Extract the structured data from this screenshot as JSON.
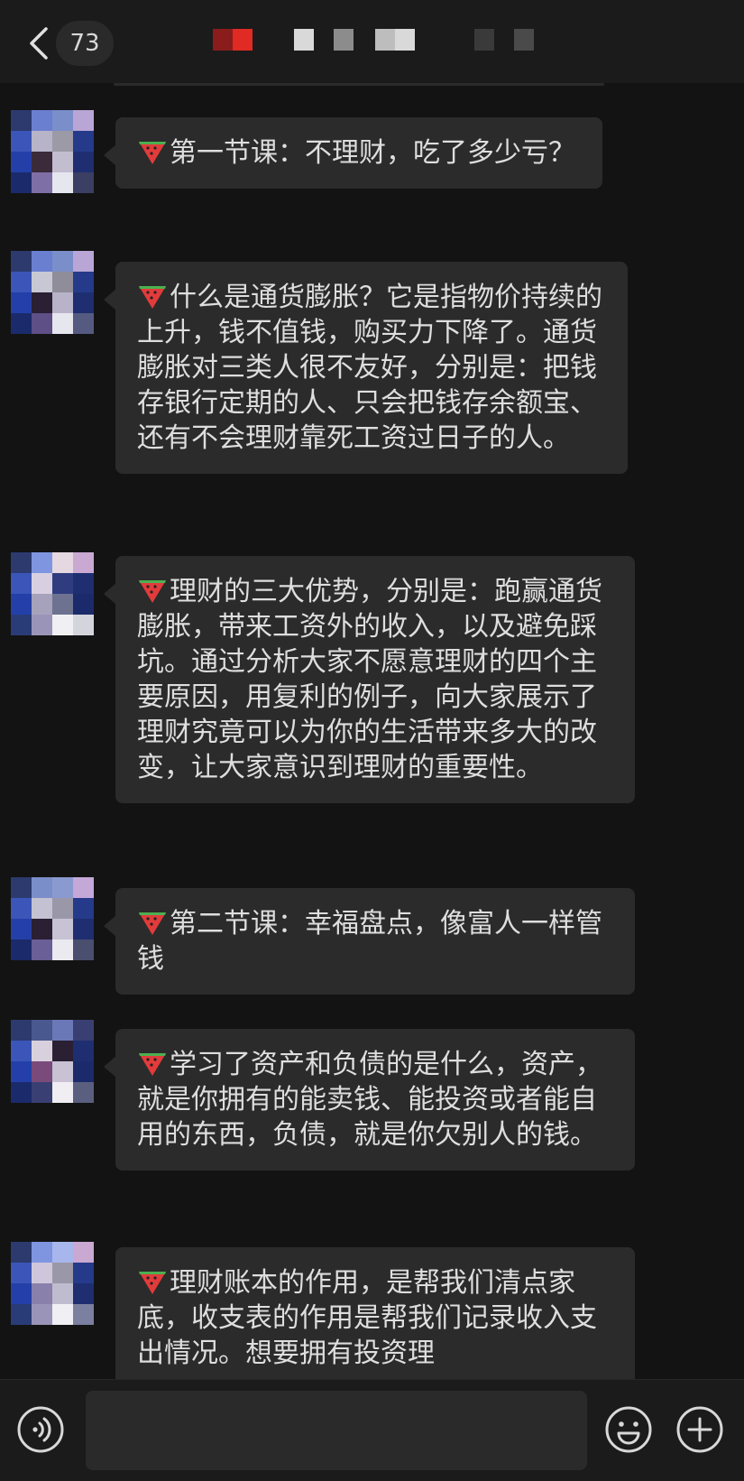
{
  "header": {
    "unread_count": "73"
  },
  "messages": [
    {
      "text": "第一节课：不理财，吃了多少亏？"
    },
    {
      "text": "什么是通货膨胀？它是指物价持续的上升，钱不值钱，购买力下降了。通货膨胀对三类人很不友好，分别是：把钱存银行定期的人、只会把钱存余额宝、还有不会理财靠死工资过日子的人。"
    },
    {
      "text": "理财的三大优势，分别是：跑赢通货膨胀，带来工资外的收入，以及避免踩坑。通过分析大家不愿意理财的四个主要原因，用复利的例子，向大家展示了理财究竟可以为你的生活带来多大的改变，让大家意识到理财的重要性。"
    },
    {
      "text": "第二节课：幸福盘点，像富人一样管钱"
    },
    {
      "text": "学习了资产和负债的是什么，资产，就是你拥有的能卖钱、能投资或者能自用的东西，负债，就是你欠别人的钱。"
    },
    {
      "text": "理财账本的作用，是帮我们清点家底，收支表的作用是帮我们记录收入支出情况。想要拥有投资理"
    }
  ],
  "input": {
    "value": ""
  },
  "icons": {
    "back": "chevron-left-icon",
    "message_prefix": "watermelon-icon",
    "voice": "voice-icon",
    "emoji": "emoji-icon",
    "more": "plus-icon"
  },
  "colors": {
    "background": "#131313",
    "bubble": "#2b2b2b",
    "bar": "#1b1b1b"
  }
}
